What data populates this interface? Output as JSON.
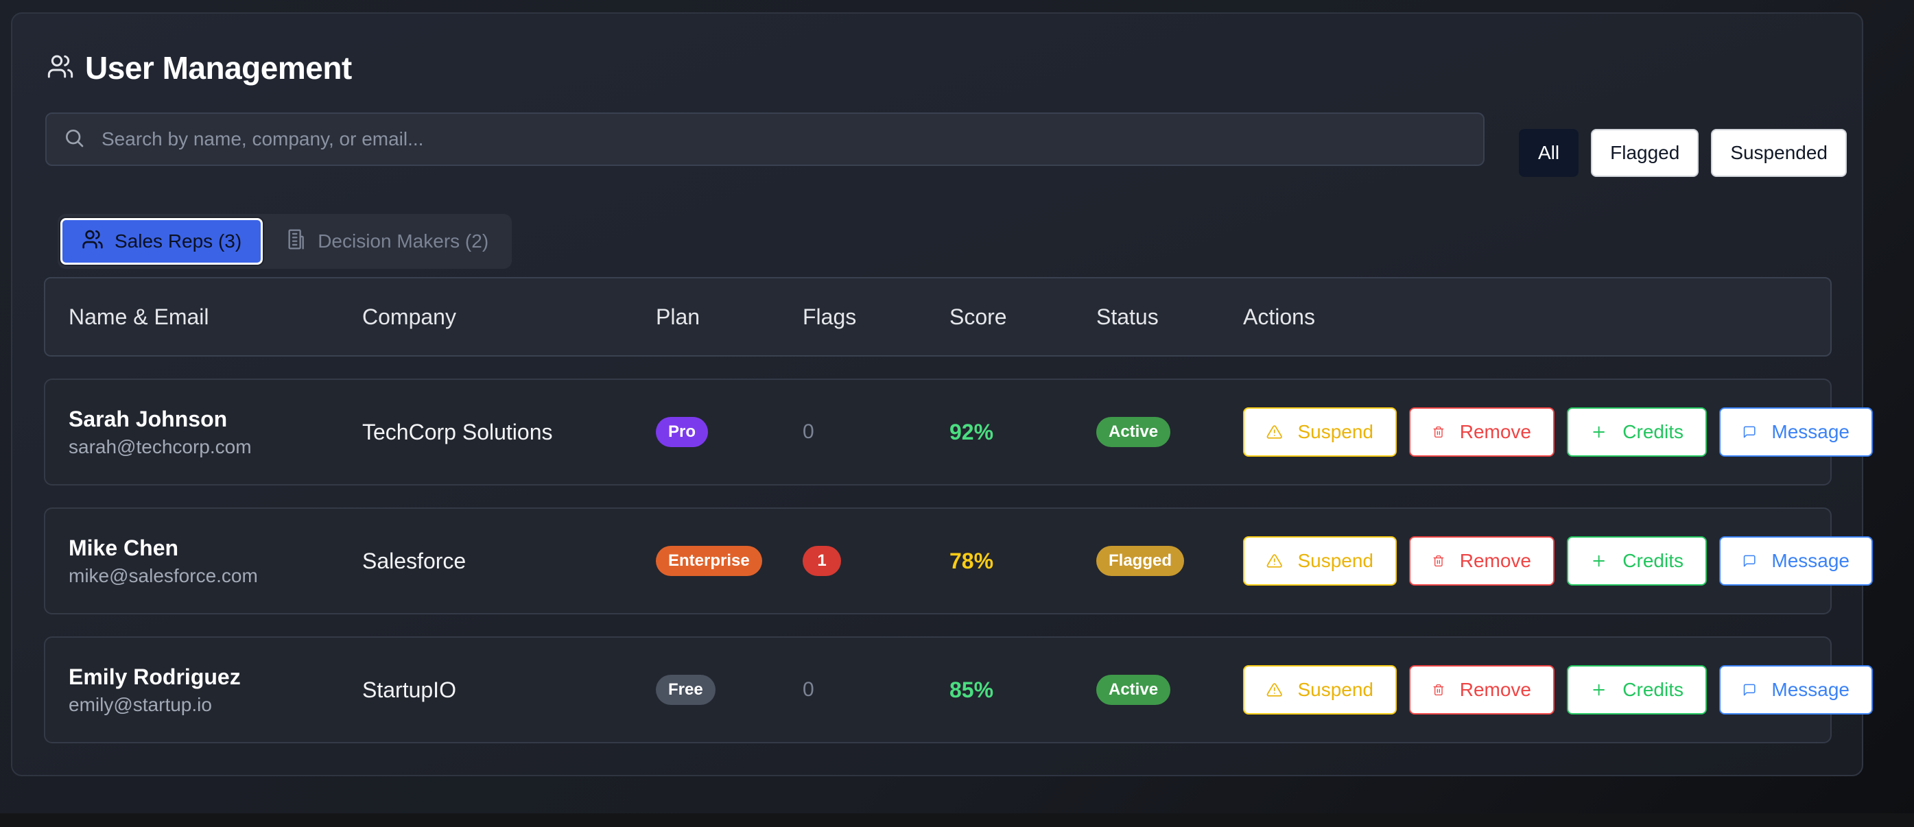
{
  "header": {
    "title": "User Management",
    "icon": "users-icon"
  },
  "search": {
    "placeholder": "Search by name, company, or email...",
    "value": ""
  },
  "filters": [
    {
      "label": "All",
      "active": true
    },
    {
      "label": "Flagged",
      "active": false
    },
    {
      "label": "Suspended",
      "active": false
    }
  ],
  "tabs": [
    {
      "label": "Sales Reps (3)",
      "icon": "users-icon",
      "active": true
    },
    {
      "label": "Decision Makers (2)",
      "icon": "building-icon",
      "active": false
    }
  ],
  "table": {
    "columns": [
      "Name & Email",
      "Company",
      "Plan",
      "Flags",
      "Score",
      "Status",
      "Actions"
    ],
    "rows": [
      {
        "name": "Sarah Johnson",
        "email": "sarah@techcorp.com",
        "company": "TechCorp Solutions",
        "plan": "Pro",
        "flags": "0",
        "score": "92%",
        "status": "Active"
      },
      {
        "name": "Mike Chen",
        "email": "mike@salesforce.com",
        "company": "Salesforce",
        "plan": "Enterprise",
        "flags": "1",
        "score": "78%",
        "status": "Flagged"
      },
      {
        "name": "Emily Rodriguez",
        "email": "emily@startup.io",
        "company": "StartupIO",
        "plan": "Free",
        "flags": "0",
        "score": "85%",
        "status": "Active"
      }
    ]
  },
  "actions": {
    "suspend": "Suspend",
    "remove": "Remove",
    "credits": "Credits",
    "message": "Message"
  },
  "colors": {
    "plan_pro": "#7c3aed",
    "plan_enterprise": "#e0622a",
    "plan_free": "#4b5260",
    "status_active": "#3f9a4a",
    "status_flagged": "#c99a2e",
    "score_high": "#4ade80",
    "score_mid": "#facc15",
    "tab_active": "#3b63e6"
  }
}
